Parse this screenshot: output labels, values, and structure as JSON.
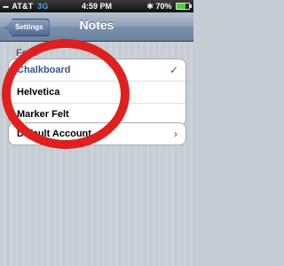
{
  "status_bar": {
    "signal": "▪▪▪▪",
    "carrier": "AT&T",
    "network": "3G",
    "time": "4:59 PM",
    "bluetooth_icon": "bluetooth-icon",
    "battery_text": "70%",
    "battery_level": 0.7
  },
  "nav": {
    "back_label": "Settings",
    "title": "Notes"
  },
  "font_section": {
    "header": "Font",
    "options": [
      {
        "label": "Chalkboard",
        "selected": true,
        "check": "✓"
      },
      {
        "label": "Helvetica",
        "selected": false
      },
      {
        "label": "Marker Felt",
        "selected": false
      }
    ]
  },
  "account_section": {
    "label": "Default Account",
    "chevron": "›"
  },
  "colors": {
    "annotation": "#e01f1f",
    "selected_text": "#385487",
    "background": "#c5ccd4"
  }
}
